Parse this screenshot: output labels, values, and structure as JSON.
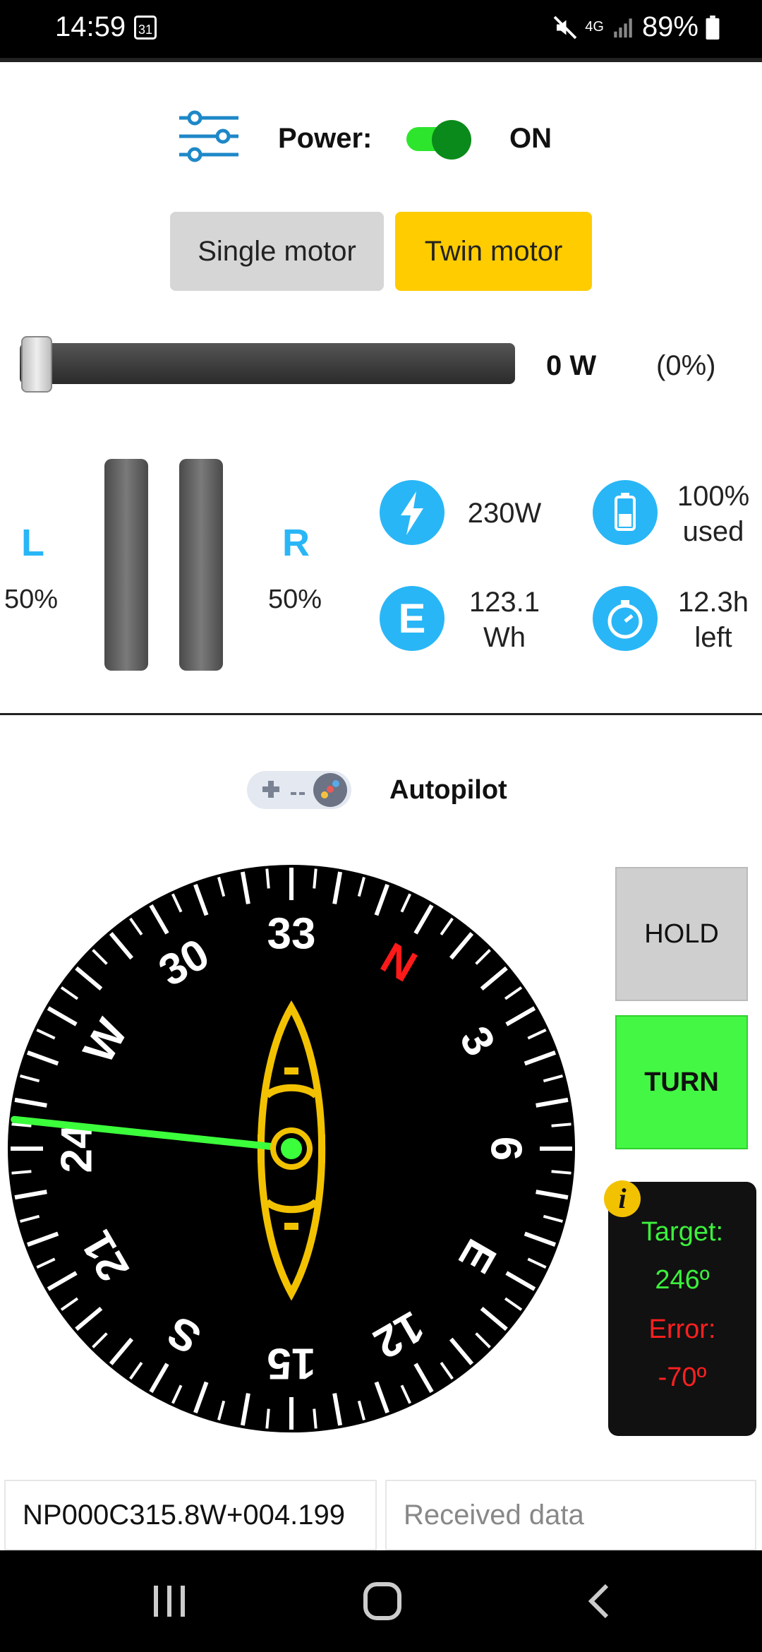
{
  "status_bar": {
    "time": "14:59",
    "calendar_day": "31",
    "network": "4G",
    "battery": "89%"
  },
  "controls": {
    "power_label": "Power:",
    "power_state": "ON",
    "power_on": true
  },
  "motor_mode": {
    "single_label": "Single motor",
    "twin_label": "Twin motor",
    "selected": "Twin motor"
  },
  "throttle": {
    "watts": "0 W",
    "percent": "(0%)",
    "level": 0
  },
  "motors": {
    "left_label": "L",
    "left_value": "50%",
    "right_label": "R",
    "right_value": "50%"
  },
  "stats": {
    "power": "230W",
    "battery_line1": "100%",
    "battery_line2": "used",
    "energy_line1": "123.1",
    "energy_line2": "Wh",
    "time_line1": "12.3h",
    "time_line2": "left"
  },
  "autopilot": {
    "title": "Autopilot",
    "hold_label": "HOLD",
    "turn_label": "TURN"
  },
  "compass": {
    "target_heading_deg": 246,
    "labels": [
      "N",
      "3",
      "6",
      "E",
      "12",
      "15",
      "S",
      "21",
      "24",
      "W",
      "30",
      "33"
    ],
    "colors": {
      "needle": "#3cff3c",
      "north": "#ff1a1a",
      "boat": "#f2c200"
    }
  },
  "info_panel": {
    "info_icon": "i",
    "target_label": "Target:",
    "target_value": "246º",
    "error_label": "Error:",
    "error_value": "-70º"
  },
  "bottom": {
    "sent_value": "NP000C315.8W+004.199",
    "received_placeholder": "Received data"
  },
  "colors": {
    "accent_blue": "#29b6f6",
    "toggle_green": "#0a8a1a",
    "twin_yellow": "#ffcc00",
    "turn_green": "#44f744",
    "hold_gray": "#cfcfcf"
  }
}
